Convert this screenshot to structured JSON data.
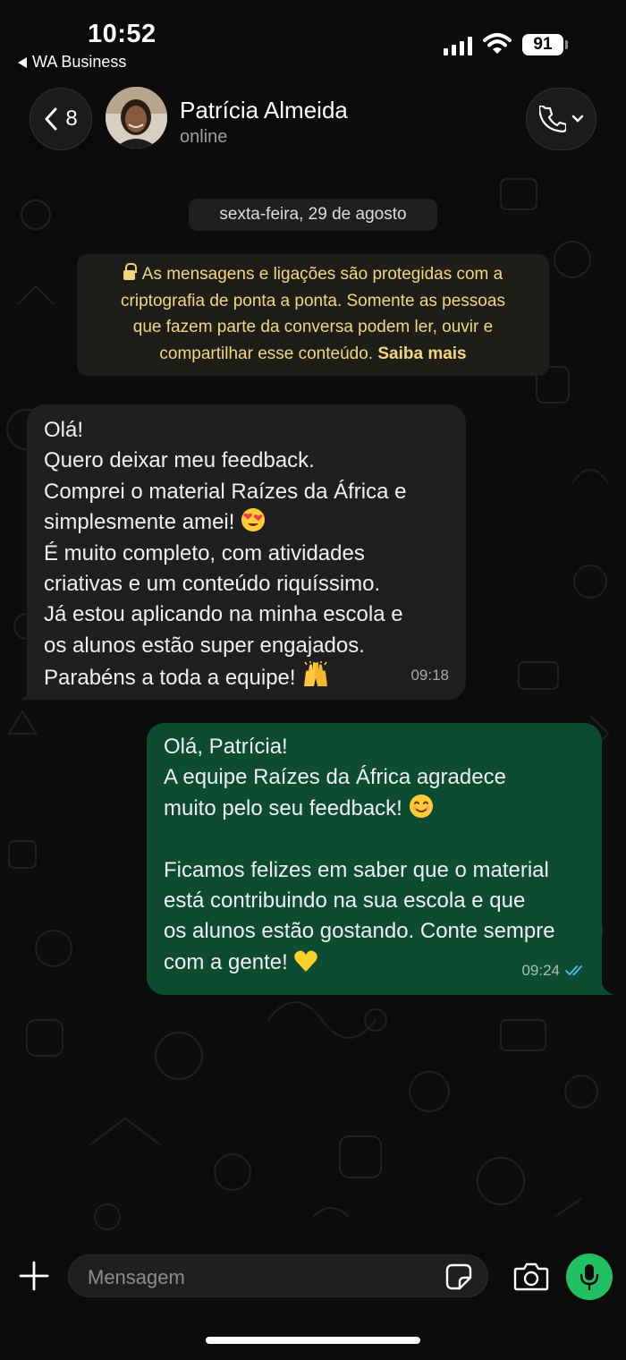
{
  "status_bar": {
    "time": "10:52",
    "back_app": "WA Business",
    "battery": "91"
  },
  "header": {
    "back_count": "8",
    "contact_name": "Patrícia Almeida",
    "contact_status": "online"
  },
  "chat": {
    "date": "sexta-feira, 29 de agosto",
    "encryption_notice": "As mensagens e ligações são protegidas com a criptografia de ponta a ponta. Somente as pessoas que fazem parte da conversa podem ler, ouvir e compartilhar esse conteúdo.",
    "encryption_lines": [
      "As mensagens e ligações são protegidas com a",
      "criptografia de ponta a ponta. Somente as pessoas",
      "que fazem parte da conversa podem ler, ouvir e",
      "compartilhar esse conteúdo."
    ],
    "learn_more": "Saiba mais",
    "messages": [
      {
        "direction": "incoming",
        "lines": [
          "Olá!",
          "Quero deixar meu feedback.",
          "Comprei o material Raízes da África e",
          "simplesmente amei!",
          "É muito completo, com atividades",
          "criativas e um conteúdo riquíssimo.",
          "Já estou aplicando na minha escola e",
          "os alunos estão super engajados.",
          "Parabéns a toda a equipe!"
        ],
        "time": "09:18"
      },
      {
        "direction": "outgoing",
        "lines": [
          "Olá, Patrícia!",
          "A equipe Raízes da África agradece",
          "muito pelo seu feedback!",
          "",
          "Ficamos felizes em saber que o material",
          "está contribuindo na sua escola e que",
          "os alunos estão gostando. Conte sempre",
          "com a gente!"
        ],
        "time": "09:24",
        "read": true
      }
    ]
  },
  "composer": {
    "placeholder": "Mensagem"
  },
  "icons": {
    "back": "chevron-left-icon",
    "call": "phone-icon",
    "add": "plus-icon",
    "sticker": "sticker-icon",
    "camera": "camera-icon",
    "mic": "microphone-icon",
    "read_receipt": "double-check-icon"
  },
  "colors": {
    "incoming_bubble": "#1f1f1f",
    "outgoing_bubble": "#0d4c33",
    "notice_text": "#f4d77a",
    "mic_button": "#21c063",
    "read_ticks": "#53bdeb"
  }
}
